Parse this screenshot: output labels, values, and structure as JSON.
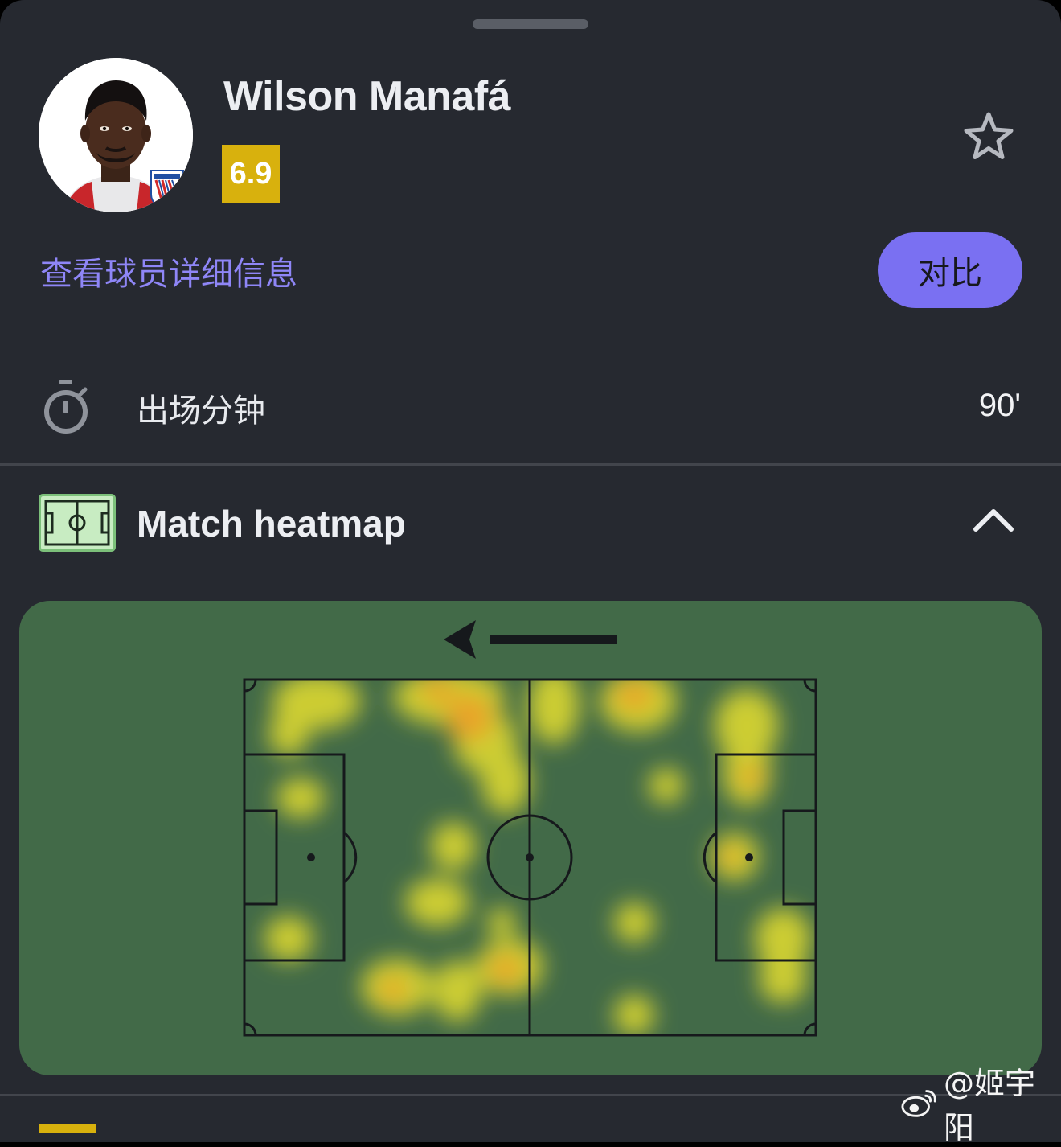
{
  "player": {
    "name": "Wilson Manafá",
    "rating": "6.9",
    "details_link": "查看球员详细信息",
    "compare_label": "对比"
  },
  "stats": {
    "minutes_label": "出场分钟",
    "minutes_value": "90'"
  },
  "heatmap": {
    "title": "Match heatmap",
    "expanded": true,
    "attack_direction": "left"
  },
  "watermark": {
    "text": "@姬宇阳"
  },
  "colors": {
    "background": "#262930",
    "accent": "#7a70f2",
    "link": "#8f86f7",
    "rating_badge": "#d8b10d",
    "pitch": "#426a48"
  },
  "icons": {
    "favorite": "star-outline-icon",
    "minutes": "stopwatch-icon",
    "heatmap": "pitch-icon",
    "collapse": "chevron-up-icon"
  }
}
